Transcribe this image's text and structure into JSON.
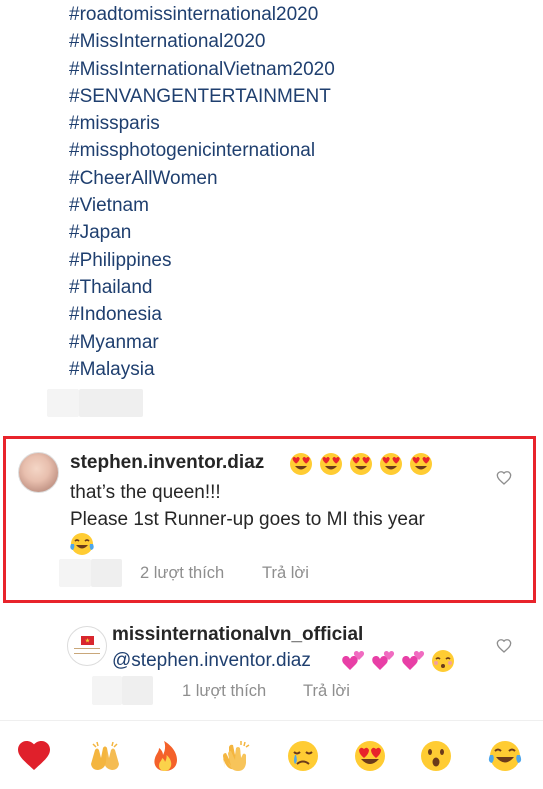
{
  "hashtags": [
    "#roadtomissinternational2020",
    "#MissInternational2020",
    "#MissInternationalVietnam2020",
    "#SENVANGENTERTAINMENT",
    "#missparis",
    "#missphotogenicinternational",
    "#CheerAllWomen",
    "#Vietnam",
    "#Japan",
    "#Philippines",
    "#Thailand",
    "#Indonesia",
    "#Myanmar",
    "#Malaysia"
  ],
  "comment": {
    "username": "stephen.inventor.diaz",
    "username_emojis": "heart-eyes ×5",
    "line1": "that’s the queen!!!",
    "line2": "Please 1st Runner-up goes to MI this year",
    "line3_emoji": "tears-of-joy",
    "likes": "2 lượt thích",
    "reply": "Trả lời",
    "highlight_color": "#e8232b"
  },
  "reply_comment": {
    "username": "missinternationalvn_official",
    "mention": "@stephen.inventor.diaz",
    "emojis": "two-hearts ×3, kissing-face",
    "likes": "1 lượt thích",
    "reply": "Trả lời"
  },
  "reactions": [
    "red-heart",
    "raising-hands",
    "fire",
    "clapping-hands",
    "crying-face",
    "heart-eyes",
    "astonished-face",
    "tears-of-joy"
  ],
  "colors": {
    "hashtag": "#1f3f6f",
    "text": "#262626",
    "meta": "#8e8e8e"
  }
}
